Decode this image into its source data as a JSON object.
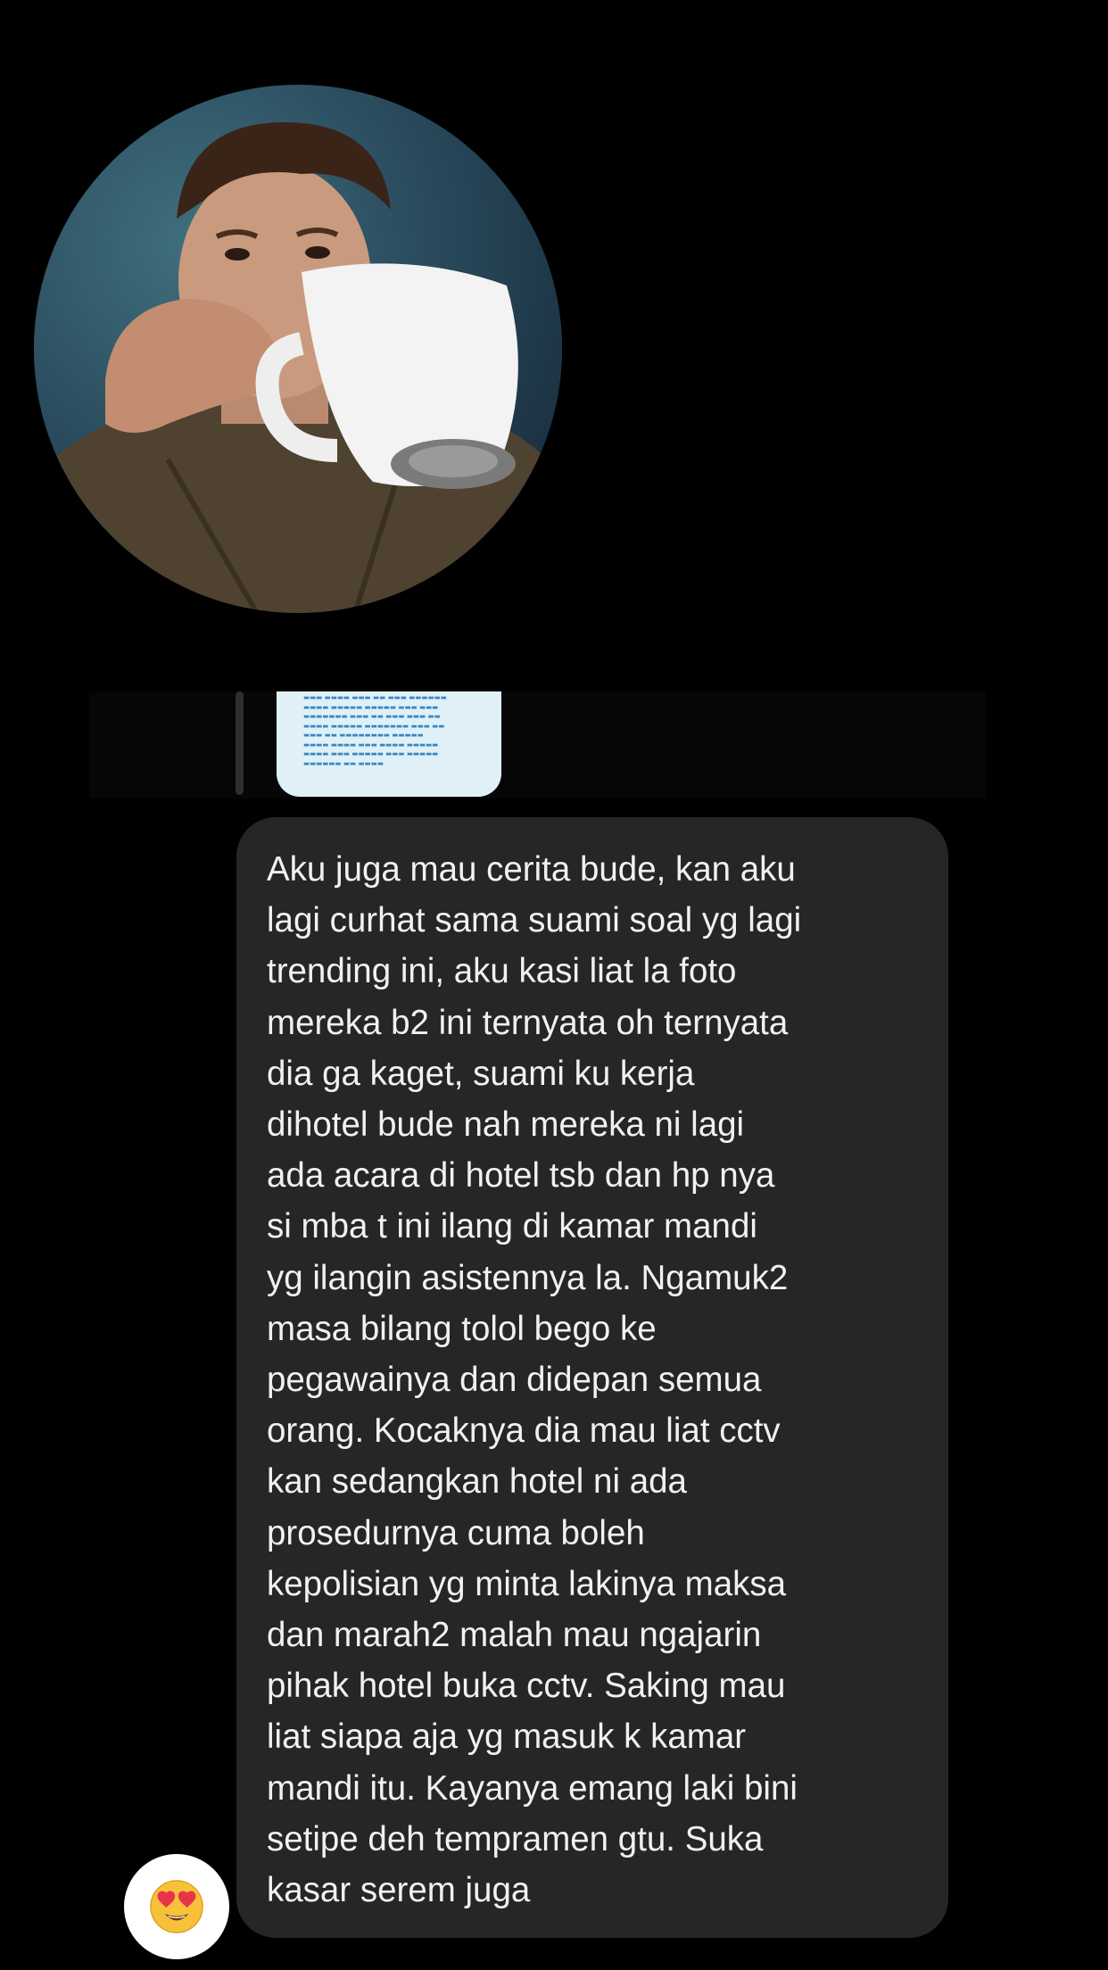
{
  "message": {
    "text": "Aku juga mau cerita bude, kan aku\nlagi curhat sama suami soal yg lagi\ntrending ini, aku kasi liat la foto\nmereka b2 ini ternyata oh ternyata\ndia ga kaget, suami ku kerja\ndihotel bude nah mereka ni lagi\nada acara di hotel tsb dan hp nya\nsi mba t ini ilang di kamar mandi\nyg ilangin asistennya la. Ngamuk2\nmasa bilang tolol bego ke\npegawainya dan didepan semua\norang. Kocaknya dia mau liat cctv\nkan sedangkan hotel ni ada\nprosedurnya cuma boleh\nkepolisian yg minta lakinya maksa\ndan marah2 malah mau ngajarin\npihak hotel buka cctv. Saking mau\nliat siapa aja yg masuk k kamar\nmandi itu. Kayanya emang laki bini\nsetipe deh tempramen gtu. Suka\nkasar serem juga"
  },
  "reaction": {
    "icon": "heart-eyes-emoji-icon"
  },
  "colors": {
    "background": "#000000",
    "bubble": "#262626",
    "text": "#f1f1f1",
    "reply_thumb": "#dff1f6"
  }
}
